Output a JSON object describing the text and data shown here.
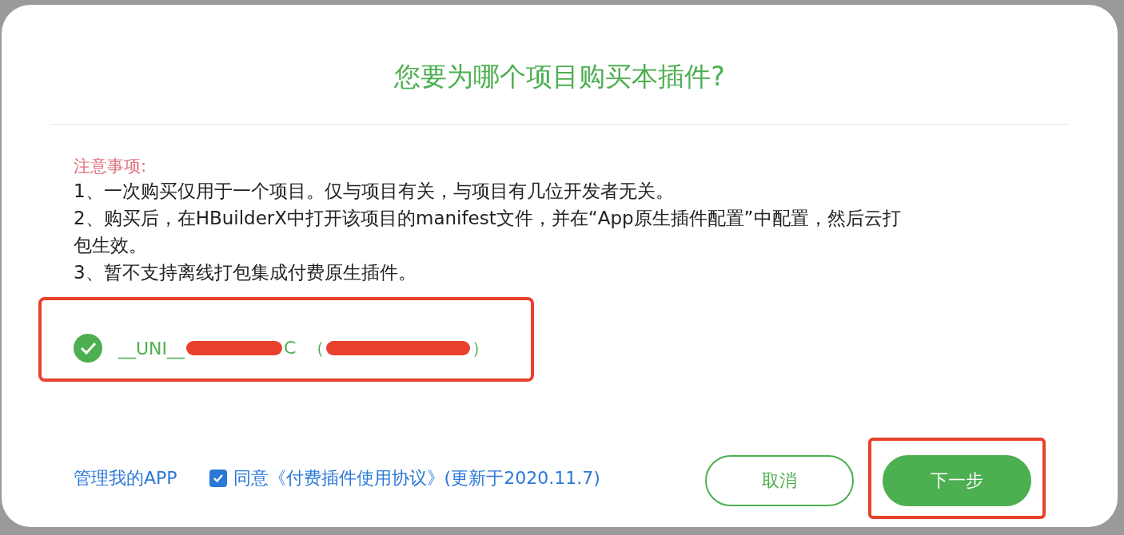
{
  "dialog": {
    "title": "您要为哪个项目购买本插件?",
    "notice": {
      "heading": "注意事项:",
      "lines": [
        "1、一次购买仅用于一个项目。仅与项目有关，与项目有几位开发者无关。",
        "2、购买后，在HBuilderX中打开该项目的manifest文件，并在“App原生插件配置”中配置，然后云打包生效。",
        "3、暂不支持离线打包集成付费原生插件。"
      ]
    },
    "projects": [
      {
        "id_start": "__UNI__",
        "id_end": "C",
        "name_open": "（",
        "name_close": "）",
        "selected": true,
        "highlighted": true
      }
    ],
    "footer": {
      "manage_link": "管理我的APP",
      "agree": {
        "checked": true,
        "text": "同意《付费插件使用协议》(更新于2020.11.7)"
      },
      "buttons": [
        {
          "label": "取消",
          "kind": "secondary",
          "highlighted": false
        },
        {
          "label": "下一步",
          "kind": "primary",
          "highlighted": true
        }
      ]
    }
  }
}
